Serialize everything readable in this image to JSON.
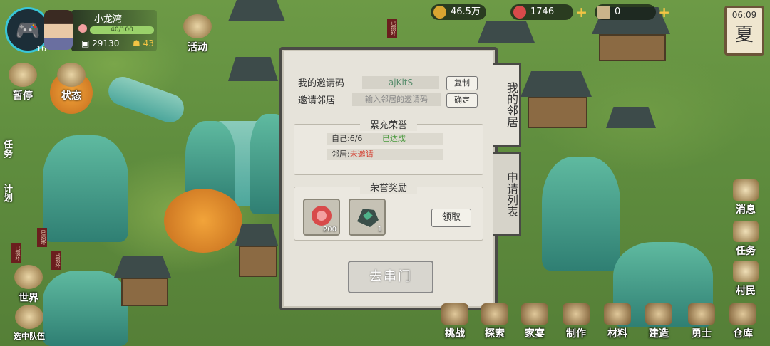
{
  "player": {
    "name": "小龙湾",
    "level": "16",
    "bar_text": "40/100",
    "coins": "29130",
    "population": "43"
  },
  "left_menu": {
    "activity": "活动",
    "pause": "暂停",
    "status": "状态",
    "world": "世界",
    "squad": "选中队伍"
  },
  "left_tabs": {
    "task": "任务",
    "plan": "计划"
  },
  "resources": {
    "copper": "46.5万",
    "gems": "1746",
    "tickets": "0"
  },
  "clock": {
    "time": "06:09",
    "season": "夏"
  },
  "map_signs": {
    "broken": "已损坏"
  },
  "dialog": {
    "my_code_label": "我的邀请码",
    "my_code_value": "ajKltS",
    "copy_button": "复制",
    "invite_label": "邀请邻居",
    "invite_placeholder": "输入邻居的邀请码",
    "confirm_button": "确定",
    "honor_title": "累充荣誉",
    "self_label": "自己:",
    "self_value": "6/6",
    "self_status": "已达成",
    "neighbor_label": "邻居:",
    "neighbor_status": "未邀请",
    "reward_title": "荣誉奖励",
    "rewards": [
      {
        "icon": "red-seal-icon",
        "count": "200"
      },
      {
        "icon": "jade-stone-icon",
        "count": "1"
      }
    ],
    "claim_button": "领取",
    "go_button": "去串门",
    "tabs": [
      {
        "label": "我的邻居"
      },
      {
        "label": "申请列表"
      }
    ]
  },
  "right_menu": {
    "message": "消息",
    "task": "任务",
    "villager": "村民"
  },
  "bottom_menu": [
    "挑战",
    "探索",
    "家宴",
    "制作",
    "材料",
    "建造",
    "勇士",
    "仓库"
  ],
  "colors": {
    "accent": "#39c6d8",
    "gold": "#f3c444",
    "red": "#d33b2c",
    "green": "#5a8e6e"
  }
}
